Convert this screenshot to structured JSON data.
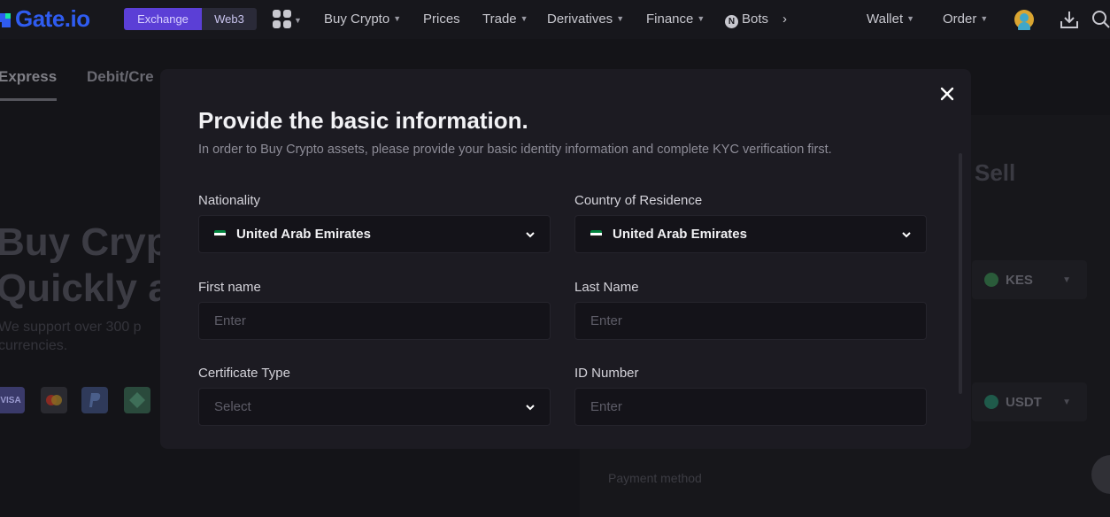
{
  "nav": {
    "logo": "Gate.io",
    "exchange": "Exchange",
    "web3": "Web3",
    "items": [
      "Buy Crypto",
      "Prices",
      "Trade",
      "Derivatives",
      "Finance",
      "Bots"
    ],
    "wallet": "Wallet",
    "order": "Order"
  },
  "page": {
    "tabs": [
      "Express",
      "Debit/Cre"
    ],
    "hero_lines": [
      "Buy Cryp",
      "Quickly a"
    ],
    "hero_sub_lines": [
      "We support over 300 p",
      "currencies."
    ],
    "sell_label": "Sell",
    "fiat_currency": "KES",
    "crypto_currency": "USDT",
    "payment_method_label": "Payment method",
    "visa_label": "VISA"
  },
  "modal": {
    "title": "Provide the basic information.",
    "description": "In order to Buy Crypto assets, please provide your basic identity information and complete KYC verification first.",
    "fields": {
      "nationality": {
        "label": "Nationality",
        "value": "United Arab Emirates"
      },
      "residence": {
        "label": "Country of Residence",
        "value": "United Arab Emirates"
      },
      "first_name": {
        "label": "First name",
        "placeholder": "Enter"
      },
      "last_name": {
        "label": "Last Name",
        "placeholder": "Enter"
      },
      "certificate_type": {
        "label": "Certificate Type",
        "placeholder": "Select"
      },
      "id_number": {
        "label": "ID Number",
        "placeholder": "Enter"
      }
    }
  },
  "colors": {
    "brand": "#2f5cf0",
    "exchange_pill": "#5b3fd6",
    "modal_bg": "#1c1b22",
    "field_bg": "#141319"
  }
}
